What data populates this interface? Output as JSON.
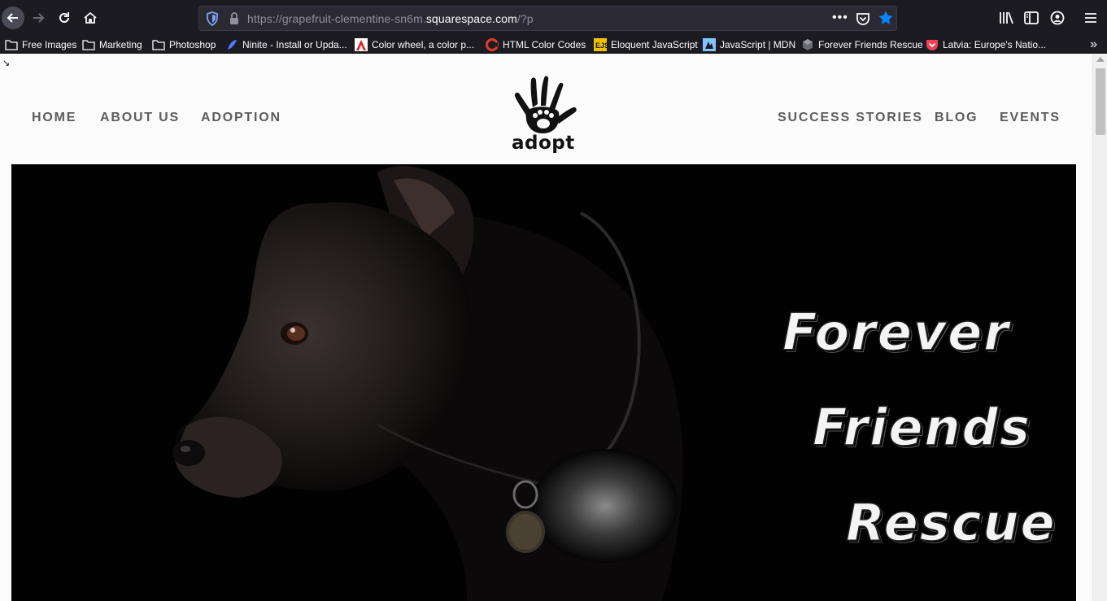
{
  "browser": {
    "url_prefix": "https://grapefruit-clementine-sn6m.",
    "url_host": "squarespace.com",
    "url_suffix": "/?p",
    "url_more": "•••",
    "bookmarks": [
      {
        "label": "Free Images",
        "icon": "folder-icon"
      },
      {
        "label": "Marketing",
        "icon": "folder-icon"
      },
      {
        "label": "Photoshop",
        "icon": "folder-icon"
      },
      {
        "label": "Ninite - Install or Upda...",
        "icon": "ninite-icon"
      },
      {
        "label": "Color wheel, a color p...",
        "icon": "adobe-icon"
      },
      {
        "label": "HTML Color Codes",
        "icon": "color-codes-icon"
      },
      {
        "label": "Eloquent JavaScript",
        "icon": "ejs-icon"
      },
      {
        "label": "JavaScript | MDN",
        "icon": "mdn-icon"
      },
      {
        "label": "Forever Friends Rescue",
        "icon": "squarespace-icon"
      },
      {
        "label": "Latvia: Europe's Natio...",
        "icon": "pocket-icon"
      }
    ],
    "overflow_glyph": "»"
  },
  "site": {
    "nav_left": [
      "HOME",
      "ABOUT US",
      "ADOPTION"
    ],
    "nav_right": [
      "SUCCESS STORIES",
      "BLOG",
      "EVENTS"
    ],
    "logo_text": "adopt",
    "hero_lines": [
      "Forever",
      "Friends",
      "Rescue"
    ]
  },
  "colors": {
    "chrome_bg": "#1c1b22",
    "url_bg": "#2b2a33",
    "star_blue": "#0a84ff",
    "nav_text": "#5c5c5c",
    "hero_bg": "#020202"
  }
}
